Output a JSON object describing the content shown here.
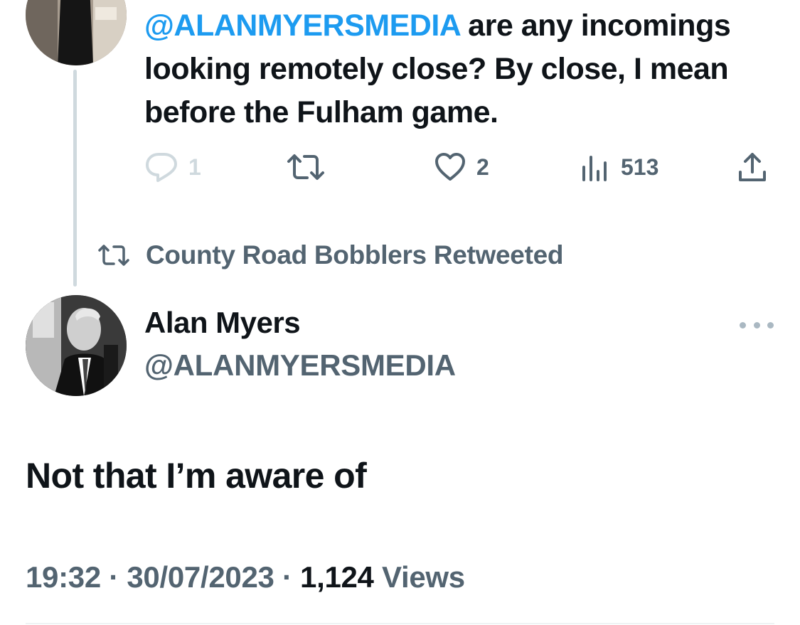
{
  "reply_tweet": {
    "mention": "@ALANMYERSMEDIA",
    "text": " are any incomings looking remotely close? By close, I mean before the Fulham game.",
    "actions": {
      "reply_count": "1",
      "like_count": "2",
      "views_count": "513"
    }
  },
  "retweet_banner": {
    "label": "County Road Bobblers Retweeted"
  },
  "main_tweet": {
    "display_name": "Alan Myers",
    "handle": "@ALANMYERSMEDIA",
    "text": "Not that I’m aware of",
    "time": "19:32",
    "date": "30/07/2023",
    "separator": "·",
    "views_count": "1,124",
    "views_label": "Views"
  },
  "colors": {
    "link": "#1d9bf0",
    "secondary_text": "#536471",
    "primary_text": "#0f1419",
    "thread_line": "#cfd9de"
  },
  "icons": [
    "reply-icon",
    "retweet-icon",
    "like-icon",
    "views-icon",
    "share-icon",
    "more-icon"
  ]
}
